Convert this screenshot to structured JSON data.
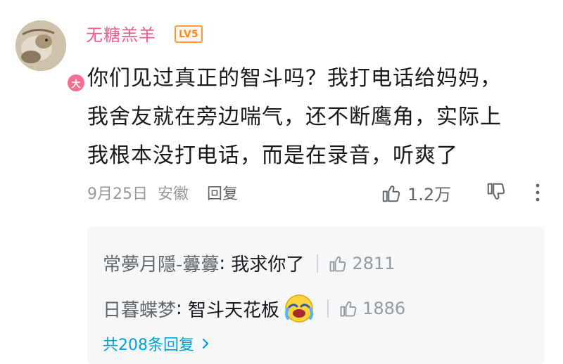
{
  "comment": {
    "username": "无糖羔羊",
    "level": "LV5",
    "avatar_badge": "大",
    "lines": [
      "你们见过真正的智斗吗？我打电话给妈妈，",
      "我舍友就在旁边喘气，还不断鹰角，实际上",
      "我根本没打电话，而是在录音，听爽了"
    ],
    "date": "9月25日",
    "location": "安徽",
    "reply_label": "回复",
    "like_count": "1.2万",
    "icons": [
      "thumb-up-icon",
      "thumb-down-icon",
      "more-icon"
    ]
  },
  "replies": [
    {
      "username": "常夢月隱-虋虋",
      "text": "我求你了",
      "likes": "2811"
    },
    {
      "username": "日暮蝶梦",
      "text": "智斗天花板",
      "likes": "1886",
      "emoji": "laughing-crying-emoji"
    }
  ],
  "view_all": "共208条回复",
  "colors": {
    "username": "#f25d8e",
    "level_badge": "#ff8a1f",
    "link": "#00a1d6",
    "meta": "#9499a0",
    "sub_box": "#f6f7f8"
  }
}
